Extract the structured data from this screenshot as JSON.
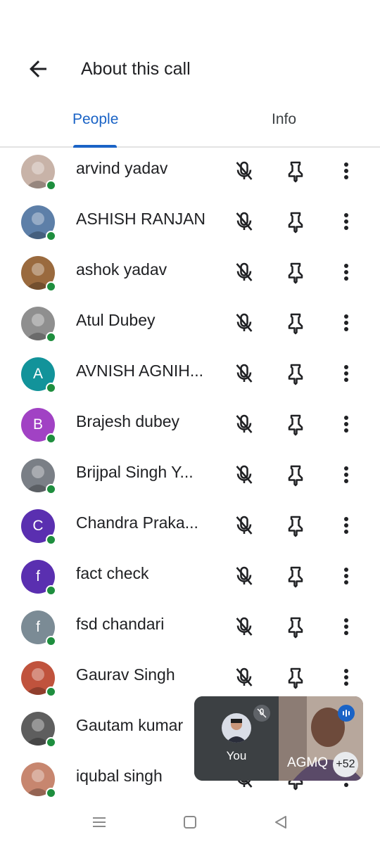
{
  "header": {
    "title": "About this call"
  },
  "tabs": [
    {
      "label": "People"
    },
    {
      "label": "Info"
    }
  ],
  "participants": [
    {
      "name": "arvind yadav",
      "avatar": "photo",
      "color": "#c8b3a8"
    },
    {
      "name": "ASHISH RANJAN",
      "avatar": "photo",
      "color": "#5d7fa8"
    },
    {
      "name": "ashok yadav",
      "avatar": "photo",
      "color": "#9a6a3e"
    },
    {
      "name": "Atul Dubey",
      "avatar": "photo",
      "color": "#8f8f8f"
    },
    {
      "name": "AVNISH AGNIH...",
      "avatar": "letter",
      "letter": "A",
      "color": "#12939a"
    },
    {
      "name": "Brajesh dubey",
      "avatar": "letter",
      "letter": "B",
      "color": "#a142c4"
    },
    {
      "name": "Brijpal Singh Y...",
      "avatar": "photo",
      "color": "#7a7f86"
    },
    {
      "name": "Chandra Praka...",
      "avatar": "letter",
      "letter": "C",
      "color": "#5a2fb0"
    },
    {
      "name": "fact check",
      "avatar": "letter",
      "letter": "f",
      "color": "#5a2fb0"
    },
    {
      "name": "fsd chandari",
      "avatar": "letter",
      "letter": "f",
      "color": "#7b8b95"
    },
    {
      "name": "Gaurav Singh",
      "avatar": "photo",
      "color": "#c0533d"
    },
    {
      "name": "Gautam kumar",
      "avatar": "photo",
      "color": "#5e5e5e"
    },
    {
      "name": "iqubal singh",
      "avatar": "photo",
      "color": "#c7866f"
    }
  ],
  "pip": {
    "self_label": "You",
    "other_label": "AGMQ",
    "extra_count": "+52"
  },
  "icons": {
    "back": "arrow-left-icon",
    "mic": "mic-off-icon",
    "pin": "pin-icon",
    "more": "more-vert-icon",
    "nav": [
      "menu-icon",
      "home-icon",
      "back-triangle-icon"
    ]
  },
  "colors": {
    "accent": "#1a63c6",
    "online": "#1e8e3e"
  }
}
